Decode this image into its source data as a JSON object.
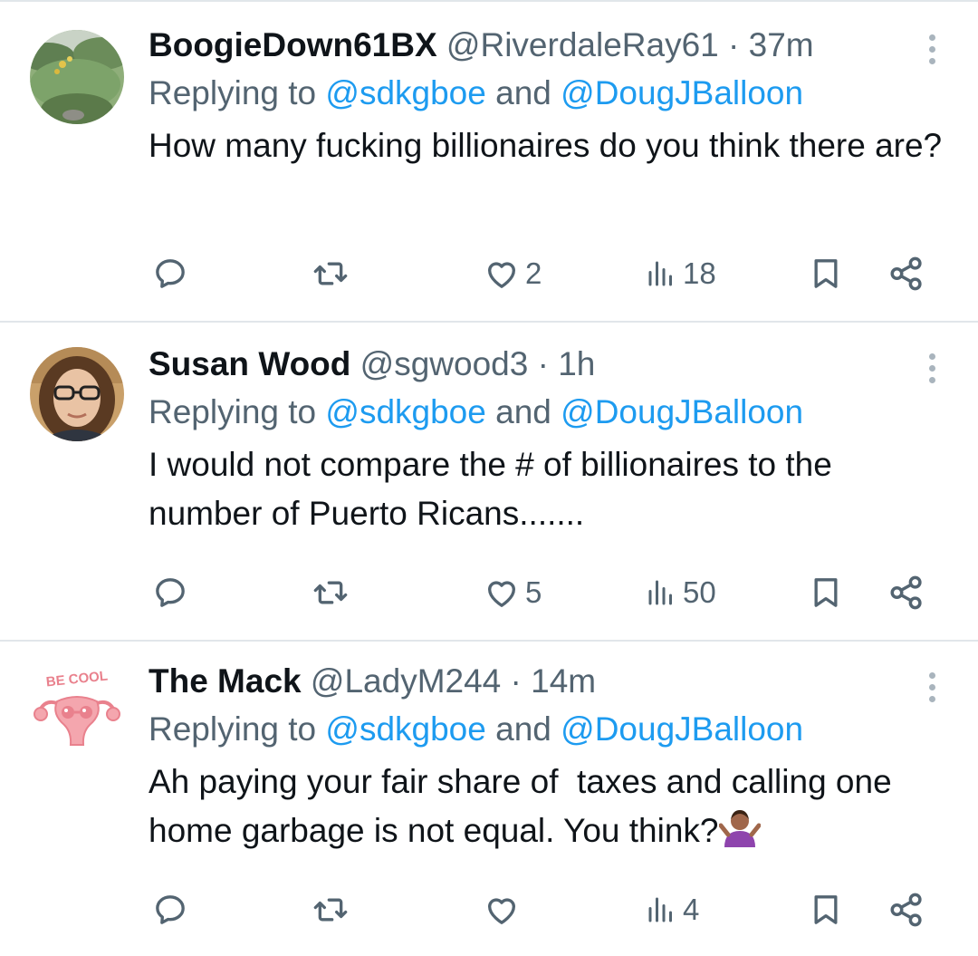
{
  "replies": [
    {
      "name": "BoogieDown61BX",
      "handle": "@RiverdaleRay61",
      "dot": "·",
      "time": "37m",
      "replying_prefix": "Replying to ",
      "mention1": "@sdkgboe",
      "and": " and ",
      "mention2": "@DougJBalloon",
      "text": "How many fucking billionaires do you think there are?",
      "likes": "2",
      "views": "18",
      "avatar": "garden-photo"
    },
    {
      "name": "Susan Wood",
      "handle": "@sgwood3",
      "dot": "·",
      "time": "1h",
      "replying_prefix": "Replying to ",
      "mention1": "@sdkgboe",
      "and": " and ",
      "mention2": "@DougJBalloon",
      "text": "I would not compare the # of billionaires to the number of Puerto Ricans.......",
      "likes": "5",
      "views": "50",
      "avatar": "woman-with-glasses-photo"
    },
    {
      "name": "The Mack",
      "handle": "@LadyM244",
      "dot": "·",
      "time": "14m",
      "replying_prefix": "Replying to ",
      "mention1": "@sdkgboe",
      "and": " and ",
      "mention2": "@DougJBalloon",
      "text": "Ah paying your fair share of  taxes and calling one home garbage is not equal. You think?",
      "emoji": "person-shrugging-emoji",
      "likes": "",
      "views": "4",
      "avatar": "be-cool-uterus-cartoon",
      "avatar_text": "BE COOL"
    }
  ],
  "icons": [
    "reply-icon",
    "retweet-icon",
    "heart-icon",
    "views-icon",
    "bookmark-icon",
    "share-icon",
    "more-icon"
  ],
  "colors": {
    "text": "#0f1419",
    "secondary": "#536471",
    "link": "#1d9bf0",
    "divider": "#e1e6ea",
    "avatar_pink": "#e9818d"
  }
}
